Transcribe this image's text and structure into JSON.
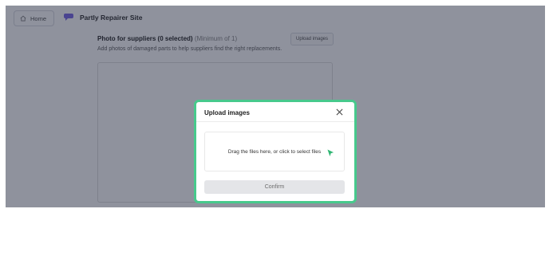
{
  "header": {
    "home_label": "Home",
    "site_name": "Partly Repairer Site"
  },
  "section": {
    "title": "Photo for suppliers (0 selected)",
    "minimum_note": "(Minimum of 1)",
    "description": "Add photos of damaged parts to help suppliers find the right replacements.",
    "upload_button_label": "Upload images"
  },
  "modal": {
    "title": "Upload images",
    "dropzone_text": "Drag the files here, or click to select files",
    "confirm_label": "Confirm"
  },
  "icons": {
    "home": "home-icon",
    "logo": "logo-icon",
    "close": "close-icon",
    "cursor": "cursor-icon"
  },
  "colors": {
    "modal_highlight": "#47c98c",
    "logo": "#7b6ae6",
    "cursor": "#2fb673"
  }
}
